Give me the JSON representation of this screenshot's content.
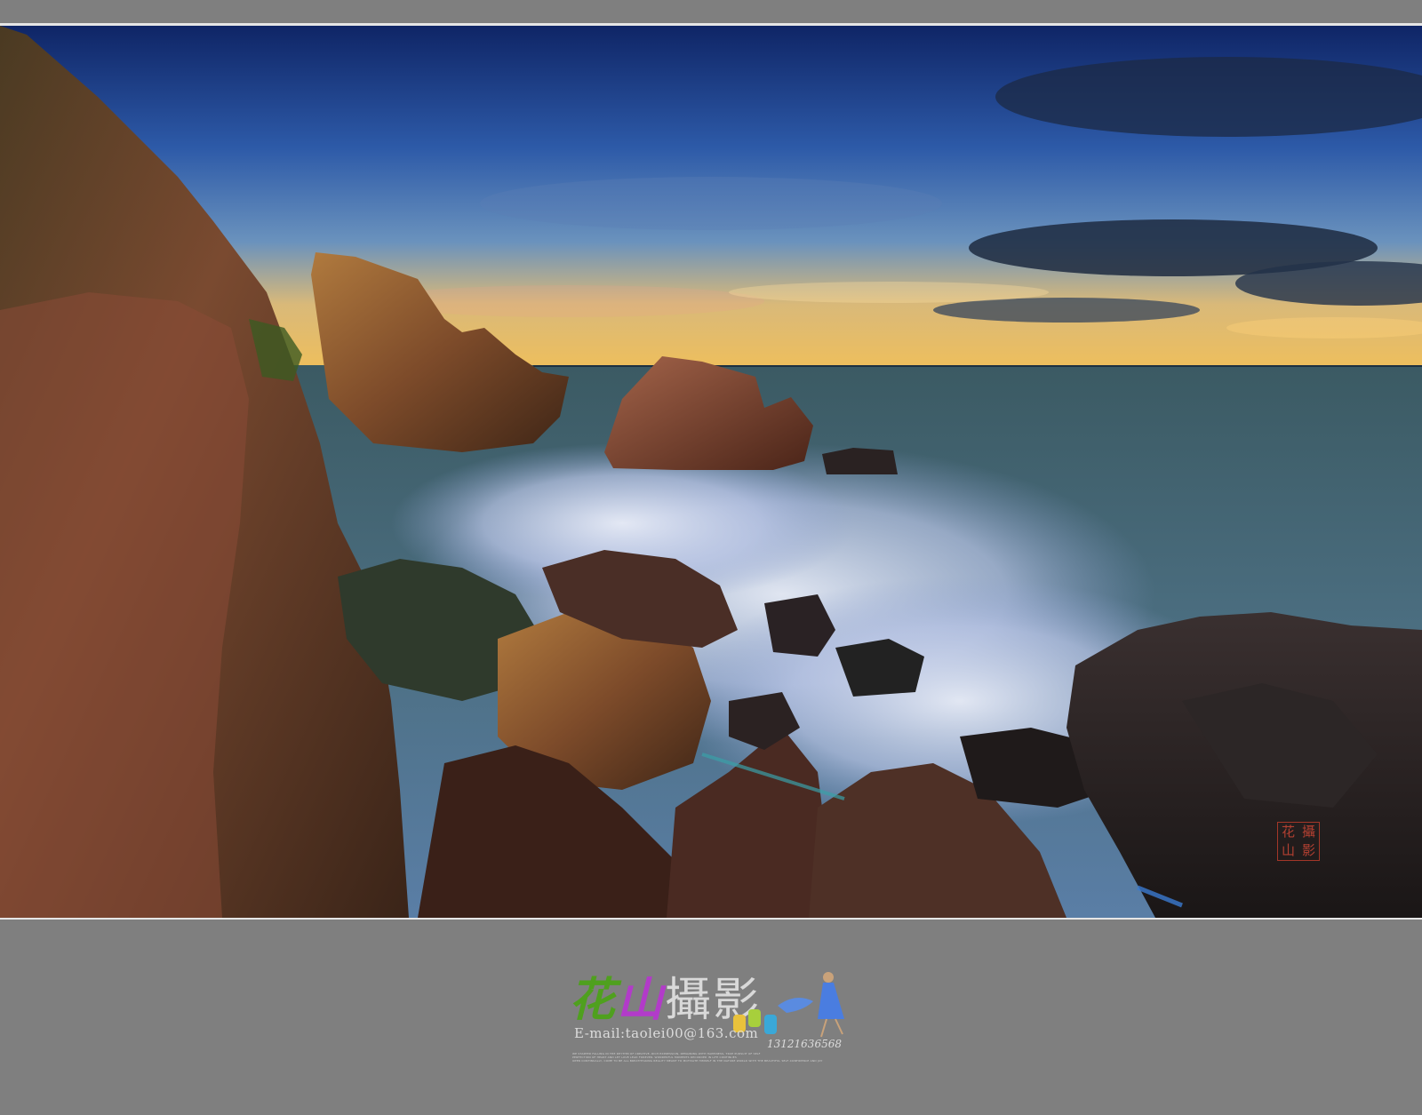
{
  "seal": {
    "chars": [
      "花",
      "攝",
      "山",
      "影"
    ]
  },
  "logo": {
    "title_part1": "花",
    "title_part2": "山",
    "title_part3": "攝影",
    "email": "E-mail:taolei00@163.com",
    "phone": "13121636568",
    "fine_print_1": "WE STARTED FALLING IN THE RHYTHM OF CREATIVE, RICH EXPRESSION, REMAINING WITH HAPPINESS, TRUE PURSUIT OF SELF",
    "fine_print_2": "PERFECTION OF HEART AND LET LOVE LEAD FOREVER. WONDERFUL MOMENTS RECORDED IN LIFE CONTINUES",
    "fine_print_3": "OPEN CONTINUALLY, COME TO BE ALL BREATHTAKING REALITY MEANT TO MOTIVATE HIMSELF IN THE NATURE WORLD WITH THE BEAUTIFUL SELF-CONFIDENCE AND JOY"
  },
  "colors": {
    "page_background": "#7f7f7f",
    "frame_line": "#e6e6e6",
    "seal_red": "#c24434",
    "logo_green": "#4fa01e",
    "logo_purple": "#b23bc9"
  }
}
